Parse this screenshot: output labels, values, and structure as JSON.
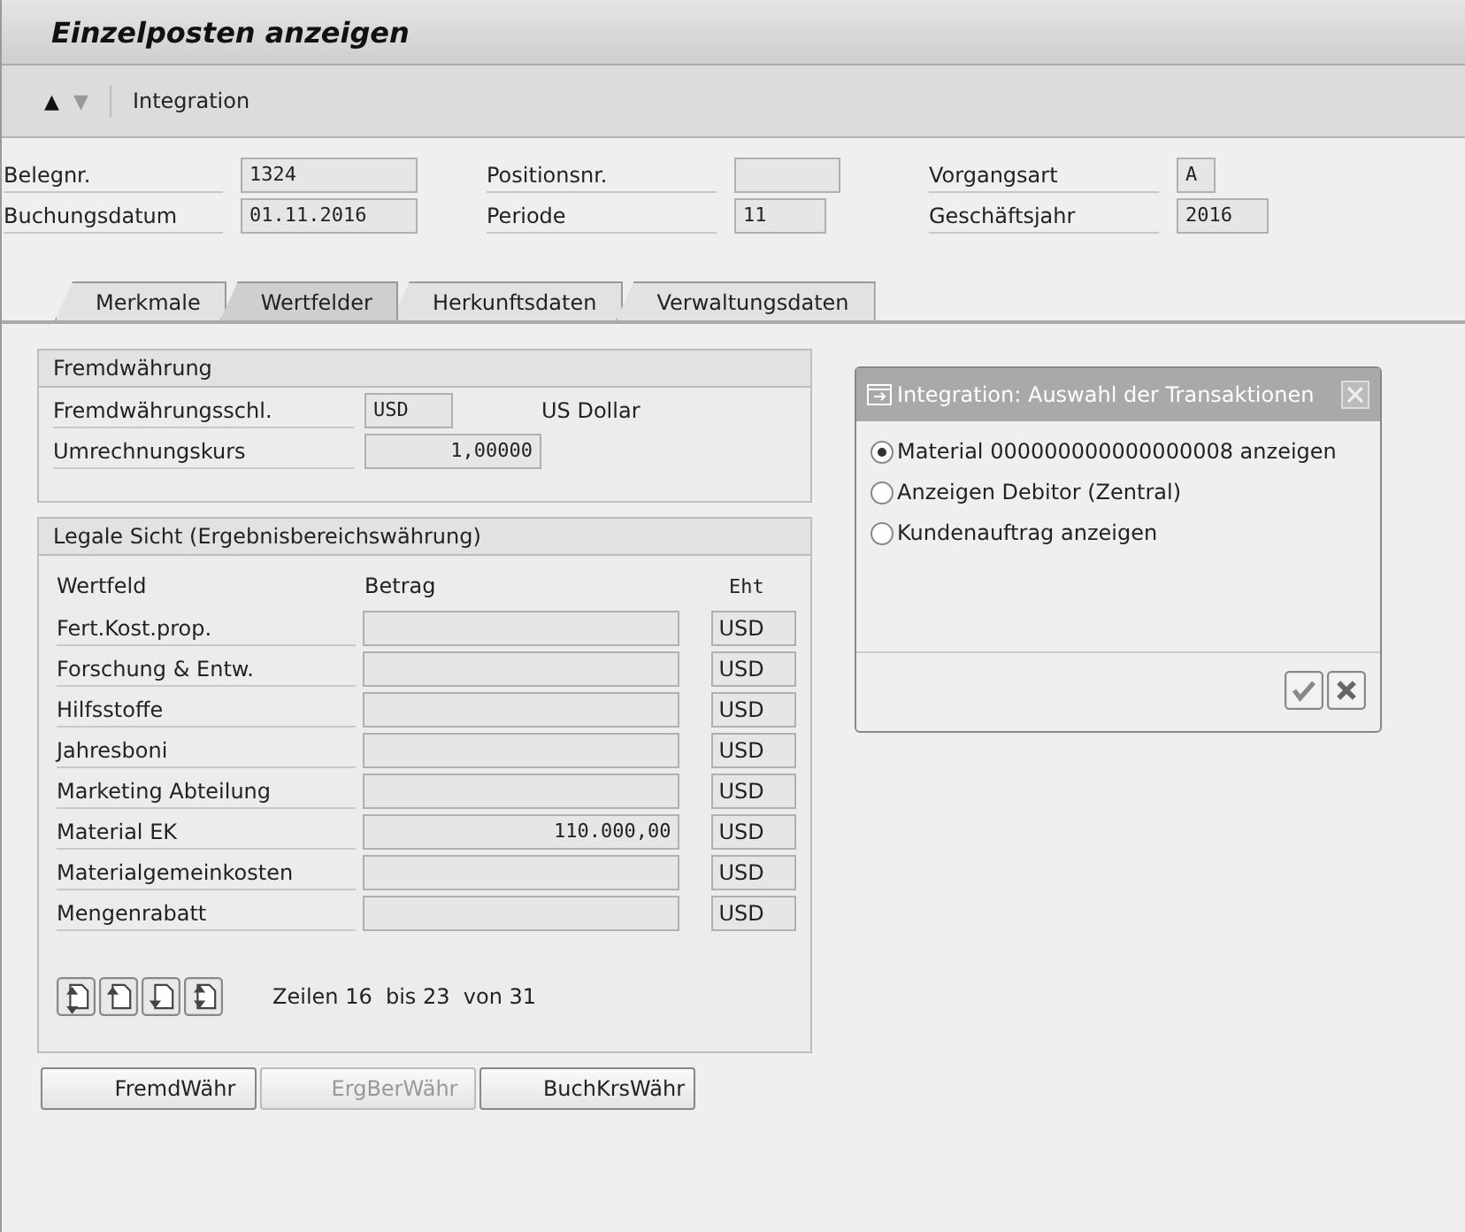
{
  "window": {
    "title": "Einzelposten anzeigen"
  },
  "toolbar": {
    "items": [
      {
        "kind": "up",
        "label": "▲",
        "disabled": false
      },
      {
        "kind": "down",
        "label": "▼",
        "disabled": true
      },
      {
        "kind": "text",
        "label": "Integration",
        "disabled": false
      }
    ]
  },
  "header_fields": [
    {
      "label": "Belegnr.",
      "value": "1324"
    },
    {
      "label": "Positionsnr."
    },
    {
      "label": "Vorgangsart",
      "value": "A"
    },
    {
      "label": "Buchungsdatum",
      "value": "01.11.2016"
    },
    {
      "label": "Periode",
      "value": "11"
    },
    {
      "label": "Geschäftsjahr",
      "value": "2016"
    }
  ],
  "tabs": [
    {
      "label": "Merkmale",
      "selected": false
    },
    {
      "label": "Wertfelder",
      "selected": true
    },
    {
      "label": "Herkunftsdaten",
      "selected": false
    },
    {
      "label": "Verwaltungsdaten",
      "selected": false
    }
  ],
  "fremdwaehrung": {
    "title": "Fremdwährung",
    "rows": [
      {
        "label": "Fremdwährungsschl.",
        "value": "USD",
        "description": "US Dollar"
      },
      {
        "label": "Umrechnungskurs",
        "value": "1,00000"
      }
    ]
  },
  "legale_sicht": {
    "title": "Legale Sicht (Ergebnisbereichswährung)",
    "columns": [
      "Wertfeld",
      "Betrag",
      "Eht"
    ],
    "rows": [
      {
        "wertfeld": "Fert.Kost.prop.",
        "eht": "USD"
      },
      {
        "wertfeld": "Forschung & Entw.",
        "eht": "USD"
      },
      {
        "wertfeld": "Hilfsstoffe",
        "eht": "USD"
      },
      {
        "wertfeld": "Jahresboni",
        "eht": "USD"
      },
      {
        "wertfeld": "Marketing Abteilung",
        "eht": "USD"
      },
      {
        "wertfeld": "Material EK",
        "betrag": "110.000,00",
        "eht": "USD"
      },
      {
        "wertfeld": "Materialgemeinkosten",
        "eht": "USD"
      },
      {
        "wertfeld": "Mengenrabatt",
        "eht": "USD"
      }
    ],
    "paging": "Zeilen 16  bis 23  von 31"
  },
  "buttons": [
    {
      "label": "FremdWähr",
      "disabled": false
    },
    {
      "label": "ErgBerWähr",
      "disabled": true
    },
    {
      "label": "BuchKrsWähr",
      "disabled": false
    }
  ],
  "dialog": {
    "title": "Integration: Auswahl der Transaktionen",
    "options": [
      {
        "label": "Material 000000000000000008 anzeigen",
        "selected": true
      },
      {
        "label": "Anzeigen Debitor (Zentral)",
        "selected": false
      },
      {
        "label": "Kundenauftrag anzeigen",
        "selected": false
      }
    ]
  }
}
